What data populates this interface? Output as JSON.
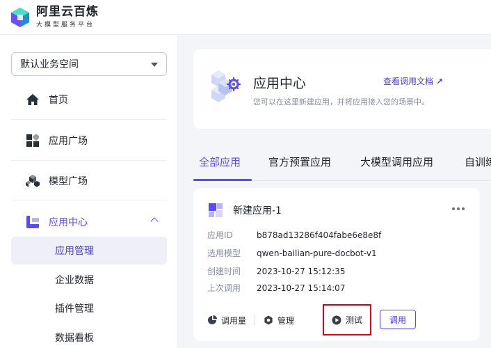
{
  "brand": {
    "title": "阿里云百炼",
    "subtitle": "大模型服务平台"
  },
  "workspace": {
    "label": "默认业务空间"
  },
  "sidebar": {
    "items": [
      {
        "label": "首页",
        "icon": "home-icon"
      },
      {
        "label": "应用广场",
        "icon": "app-grid-icon"
      },
      {
        "label": "模型广场",
        "icon": "cubes-icon"
      },
      {
        "label": "应用中心",
        "icon": "app-center-icon"
      }
    ],
    "sub_items": [
      {
        "label": "应用管理"
      },
      {
        "label": "企业数据"
      },
      {
        "label": "插件管理"
      },
      {
        "label": "数据看板"
      }
    ]
  },
  "hero": {
    "title": "应用中心",
    "desc": "您可以在这里新建应用，并将应用接入您的场景中。",
    "doc_link": "查看调用文档"
  },
  "tabs": [
    "全部应用",
    "官方预置应用",
    "大模型调用应用",
    "自训练"
  ],
  "card": {
    "title": "新建应用-1",
    "fields": [
      {
        "key": "应用ID",
        "value": "b878ad13286f404fabe6e8e8f"
      },
      {
        "key": "选用模型",
        "value": "qwen-bailian-pure-docbot-v1"
      },
      {
        "key": "创建时间",
        "value": "2023-10-27 15:12:35"
      },
      {
        "key": "上次调用",
        "value": "2023-10-27 15:14:07"
      }
    ],
    "actions": {
      "usage": "调用量",
      "manage": "管理",
      "test": "测试",
      "invoke": "调用"
    }
  },
  "colors": {
    "accent": "#5b4cf0",
    "highlight_box": "#e0001b"
  }
}
